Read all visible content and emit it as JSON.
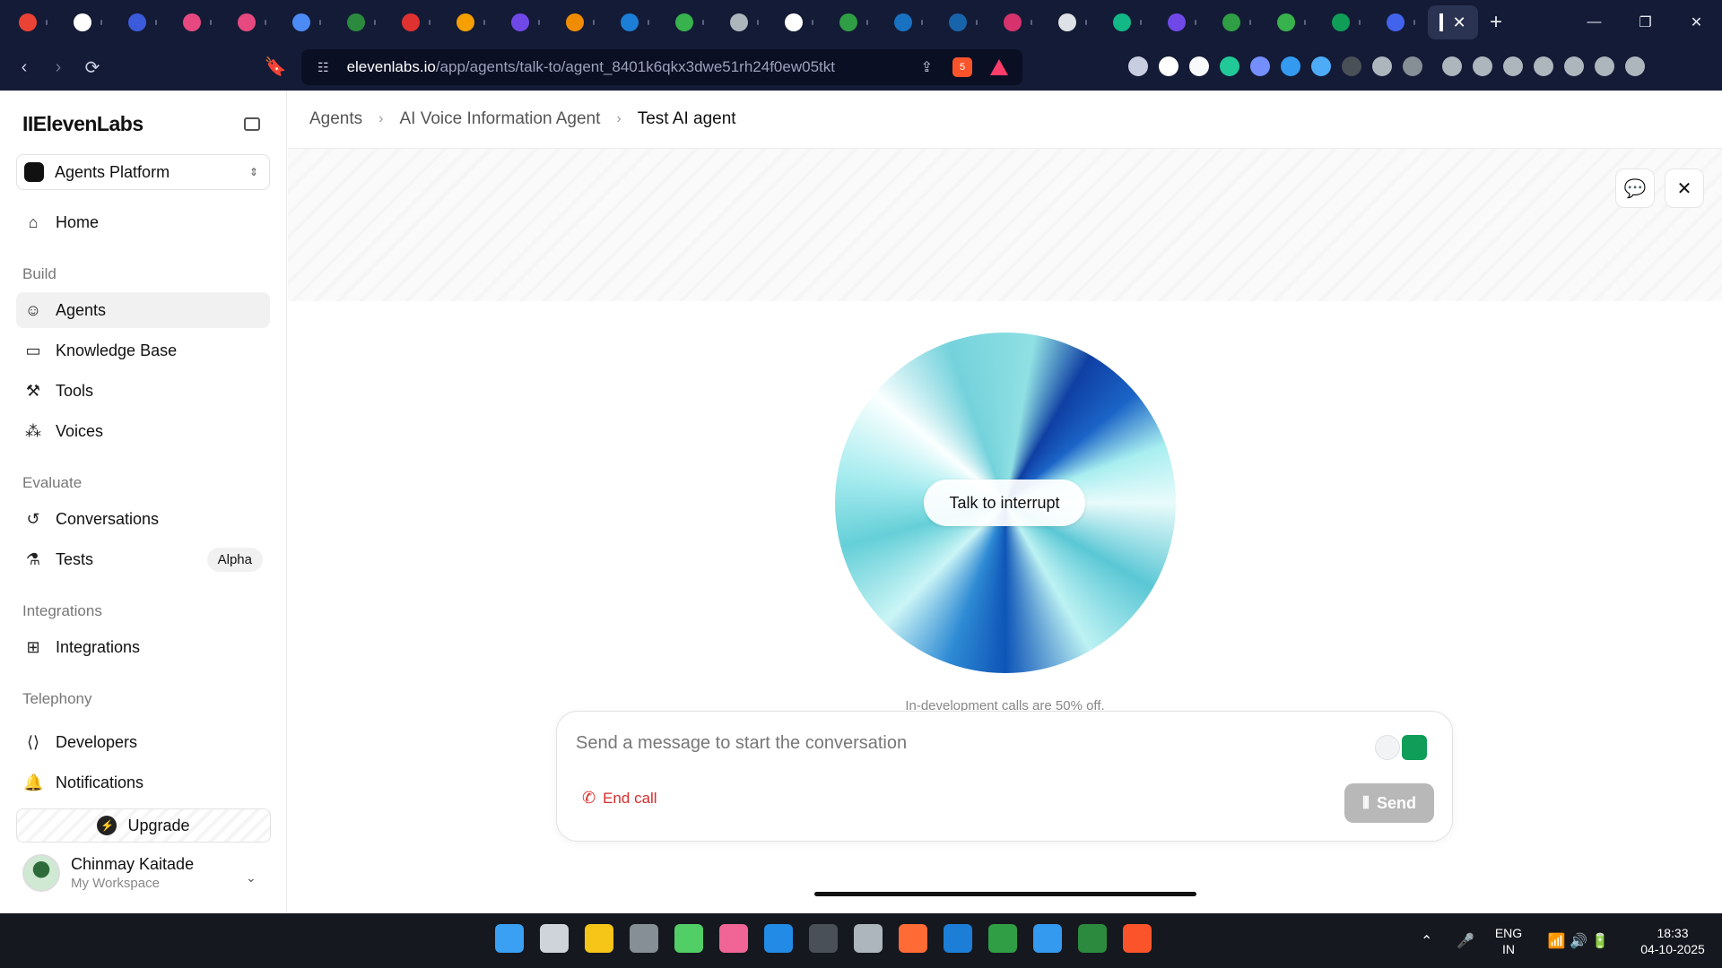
{
  "browser": {
    "tabs": [
      {
        "icon": "gmail-icon",
        "color": "#ea4335"
      },
      {
        "icon": "github-icon",
        "color": "#ffffff"
      },
      {
        "icon": "app-icon",
        "color": "#3b5bdb"
      },
      {
        "icon": "app-icon",
        "color": "#e64980"
      },
      {
        "icon": "app-icon",
        "color": "#e64980"
      },
      {
        "icon": "gemini-icon",
        "color": "#4c8bf5"
      },
      {
        "icon": "linkedin-icon",
        "color": "#2b8a3e"
      },
      {
        "icon": "youtube-icon",
        "color": "#e03131"
      },
      {
        "icon": "app-icon",
        "color": "#f59f00"
      },
      {
        "icon": "play-icon",
        "color": "#7048e8"
      },
      {
        "icon": "drive-icon",
        "color": "#f08c00"
      },
      {
        "icon": "app-icon",
        "color": "#1c7ed6"
      },
      {
        "icon": "drive-icon",
        "color": "#37b24d"
      },
      {
        "icon": "globe-icon",
        "color": "#adb5bd"
      },
      {
        "icon": "app-icon",
        "color": "#ffffff"
      },
      {
        "icon": "plus-icon",
        "color": "#2f9e44"
      },
      {
        "icon": "search-icon",
        "color": "#1971c2"
      },
      {
        "icon": "linkedin-icon",
        "color": "#1864ab"
      },
      {
        "icon": "instagram-icon",
        "color": "#d6336c"
      },
      {
        "icon": "openai-icon",
        "color": "#dee2e6"
      },
      {
        "icon": "app-icon",
        "color": "#12b886"
      },
      {
        "icon": "play-icon",
        "color": "#7048e8"
      },
      {
        "icon": "plus-icon",
        "color": "#2f9e44"
      },
      {
        "icon": "drive-icon",
        "color": "#37b24d"
      },
      {
        "icon": "sheets-icon",
        "color": "#0f9d58"
      },
      {
        "icon": "shield-icon",
        "color": "#4263eb"
      }
    ],
    "url_host": "elevenlabs.io",
    "url_path": "/app/agents/talk-to/agent_8401k6qkx3dwe51rh24f0ew05tkt",
    "brave_count": "5"
  },
  "sidebar": {
    "logo": "IIElevenLabs",
    "platform": "Agents Platform",
    "home": "Home",
    "build_section": "Build",
    "agents": "Agents",
    "knowledge_base": "Knowledge Base",
    "tools": "Tools",
    "voices": "Voices",
    "evaluate_section": "Evaluate",
    "conversations": "Conversations",
    "tests": "Tests",
    "tests_badge": "Alpha",
    "integrations_section": "Integrations",
    "integrations": "Integrations",
    "telephony_section": "Telephony",
    "developers": "Developers",
    "notifications": "Notifications",
    "upgrade": "Upgrade",
    "user_name": "Chinmay Kaitade",
    "workspace": "My Workspace"
  },
  "breadcrumb": [
    "Agents",
    "AI Voice Information Agent",
    "Test AI agent"
  ],
  "main": {
    "interrupt": "Talk to interrupt",
    "note": "In-development calls are 50% off.",
    "placeholder": "Send a message to start the conversation",
    "end_call": "End call",
    "send": "Send"
  },
  "taskbar": {
    "lang1": "ENG",
    "lang2": "IN",
    "time": "18:33",
    "date": "04-10-2025"
  }
}
